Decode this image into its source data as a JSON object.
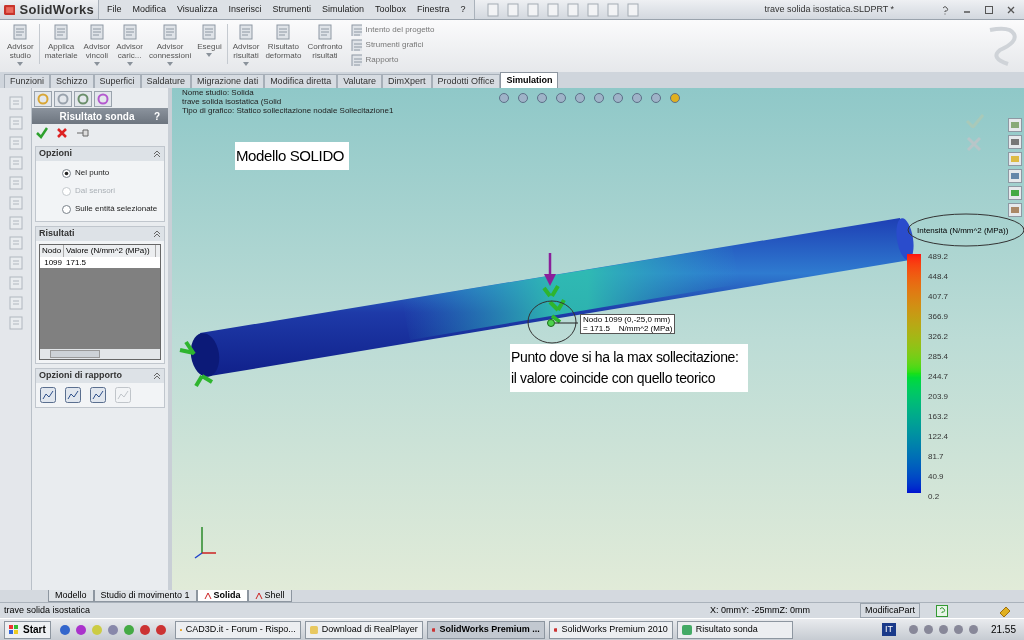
{
  "app": {
    "logo": "SolidWorks",
    "menu": [
      "File",
      "Modifica",
      "Visualizza",
      "Inserisci",
      "Strumenti",
      "Simulation",
      "Toolbox",
      "Finestra",
      "?"
    ]
  },
  "window": {
    "title": "trave solida isostatica.SLDPRT *"
  },
  "ribbon": {
    "commands": [
      {
        "lines": [
          "Advisor",
          "studio"
        ],
        "dropdown": true
      },
      {
        "lines": [
          "Applica",
          "materiale"
        ],
        "dropdown": false
      },
      {
        "lines": [
          "Advisor",
          "vincoli"
        ],
        "dropdown": true
      },
      {
        "lines": [
          "Advisor",
          "caric..."
        ],
        "dropdown": true
      },
      {
        "lines": [
          "Advisor",
          "connessioni"
        ],
        "dropdown": true
      },
      {
        "lines": [
          "Esegui"
        ],
        "dropdown": true
      },
      {
        "lines": [
          "Advisor",
          "risultati"
        ],
        "dropdown": true
      },
      {
        "lines": [
          "Risultato",
          "deformato"
        ],
        "dropdown": false
      },
      {
        "lines": [
          "Confronto",
          "risultati"
        ],
        "dropdown": false
      }
    ],
    "side_commands": [
      "Intento del progetto",
      "Strumenti grafici",
      "Rapporto"
    ]
  },
  "tabs": [
    {
      "label": "Funzioni",
      "selected": false
    },
    {
      "label": "Schizzo",
      "selected": false
    },
    {
      "label": "Superfici",
      "selected": false
    },
    {
      "label": "Saldature",
      "selected": false
    },
    {
      "label": "Migrazione dati",
      "selected": false
    },
    {
      "label": "Modifica diretta",
      "selected": false
    },
    {
      "label": "Valutare",
      "selected": false
    },
    {
      "label": "DimXpert",
      "selected": false
    },
    {
      "label": "Prodotti Office",
      "selected": false
    },
    {
      "label": "Simulation",
      "selected": true
    }
  ],
  "property_manager": {
    "title": "Risultato sonda",
    "help": "?",
    "options": {
      "title": "Opzioni",
      "items": [
        {
          "label": "Nel punto",
          "selected": true,
          "disabled": false
        },
        {
          "label": "Dal sensori",
          "selected": false,
          "disabled": true
        },
        {
          "label": "Sulle entità selezionate",
          "selected": false,
          "disabled": false
        }
      ]
    },
    "results": {
      "title": "Risultati",
      "columns": [
        "Nodo",
        "Valore (N/mm^2 (MPa))"
      ],
      "rows": [
        [
          "1099",
          "171.5"
        ]
      ]
    },
    "report": {
      "title": "Opzioni di rapporto"
    }
  },
  "viewport": {
    "study_lines": [
      "Nome studio: Solida",
      "trave solida isostatica  (Solid",
      "Tipo di grafico: Statico sollecitazione nodale Sollecitazione1"
    ],
    "note_title": "Modello SOLIDO",
    "note_text": "Punto dove si ha la max sollecitazione:\nil valore coincide con quello teorico",
    "probe": [
      "Nodo 1099 (0,-25,0 mm)",
      "= 171.5    N/mm^2 (MPa)"
    ],
    "legend": {
      "title": "Intensità (N/mm^2 (MPa))",
      "ticks": [
        "489.2",
        "448.4",
        "407.7",
        "366.9",
        "326.2",
        "285.4",
        "244.7",
        "203.9",
        "163.2",
        "122.4",
        "81.7",
        "40.9",
        "0.2"
      ]
    }
  },
  "bottom_tabs": [
    {
      "label": "Modello",
      "selected": false
    },
    {
      "label": "Studio di movimento 1",
      "selected": false
    },
    {
      "label": "Solida",
      "selected": true
    },
    {
      "label": "Shell",
      "selected": false
    }
  ],
  "status_bar": {
    "document": "trave solida isostatica",
    "coordinates": "X: 0mmY: -25mmZ: 0mm",
    "mode": "ModificaPart"
  },
  "taskbar": {
    "start": "Start",
    "tasks": [
      {
        "label": "CAD3D.it - Forum - Rispo...",
        "selected": false
      },
      {
        "label": "Download di RealPlayer",
        "selected": false
      },
      {
        "label": "SolidWorks Premium ...",
        "selected": true
      },
      {
        "label": "SolidWorks Premium 2010",
        "selected": false
      },
      {
        "label": "Risultato sonda",
        "selected": false
      }
    ],
    "language": "IT",
    "clock": "21.55"
  }
}
